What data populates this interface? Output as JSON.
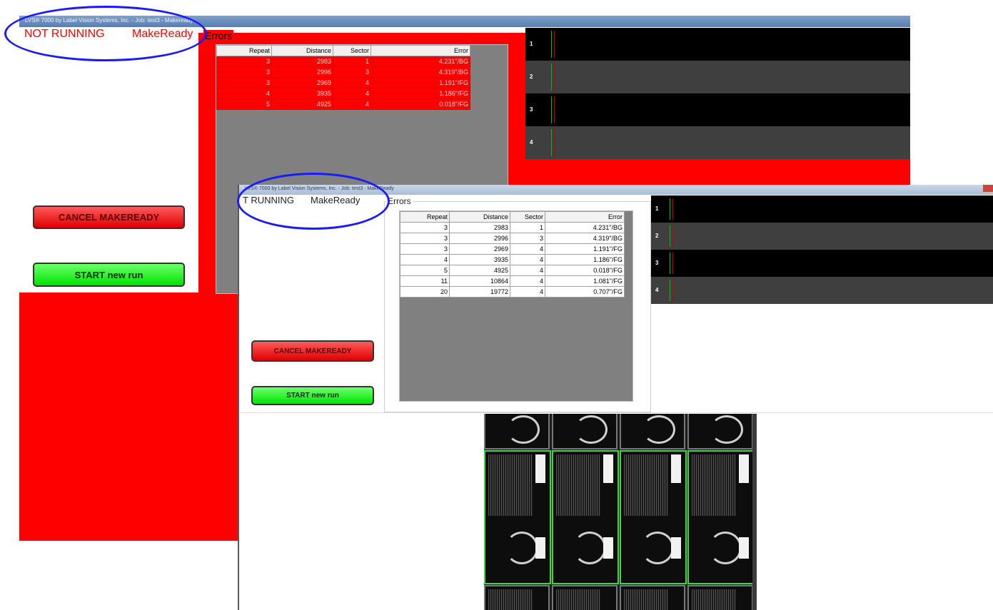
{
  "back_window": {
    "title": "LVS® 7000 by Label Vision Systems, Inc. - Job: test3 - Makeready",
    "status_running": "NOT RUNNING",
    "status_mode": "MakeReady",
    "errors_legend": "Errors",
    "columns": [
      "Repeat",
      "Distance",
      "Sector",
      "Error"
    ],
    "rows": [
      [
        "3",
        "2983",
        "1",
        "4.231\"/BG"
      ],
      [
        "3",
        "2996",
        "3",
        "4.319\"/BG"
      ],
      [
        "3",
        "2969",
        "4",
        "1.191\"/FG"
      ],
      [
        "4",
        "3935",
        "4",
        "1.186\"/FG"
      ],
      [
        "5",
        "4925",
        "4",
        "0.018\"/FG"
      ]
    ],
    "sectors": [
      "1",
      "2",
      "3",
      "4"
    ],
    "cancel_label": "CANCEL MAKEREADY",
    "start_label": "START new run"
  },
  "front_window": {
    "title": "LVS® 7000 by Label Vision Systems, Inc. - Job: test3 - MakeReady",
    "status_running": "T RUNNING",
    "status_mode": "MakeReady",
    "errors_legend": "Errors",
    "columns": [
      "Repeat",
      "Distance",
      "Sector",
      "Error"
    ],
    "rows": [
      [
        "3",
        "2983",
        "1",
        "4.231\"/BG"
      ],
      [
        "3",
        "2996",
        "3",
        "4.319\"/BG"
      ],
      [
        "3",
        "2969",
        "4",
        "1.191\"/FG"
      ],
      [
        "4",
        "3935",
        "4",
        "1.186\"/FG"
      ],
      [
        "5",
        "4925",
        "4",
        "0.018\"/FG"
      ],
      [
        "11",
        "10864",
        "4",
        "1.081\"/FG"
      ],
      [
        "20",
        "19772",
        "4",
        "0.707\"/FG"
      ]
    ],
    "sectors": [
      "1",
      "2",
      "3",
      "4"
    ],
    "cancel_label": "CANCEL MAKEREADY",
    "start_label": "START new run"
  },
  "colors": {
    "alarm_red": "#ff0000",
    "ok_green": "#00e400",
    "annotation_blue": "#1a1aff",
    "sector_dark": "#000000",
    "sector_gray": "#3f3f3f",
    "title_blue": "#5a7fae"
  }
}
